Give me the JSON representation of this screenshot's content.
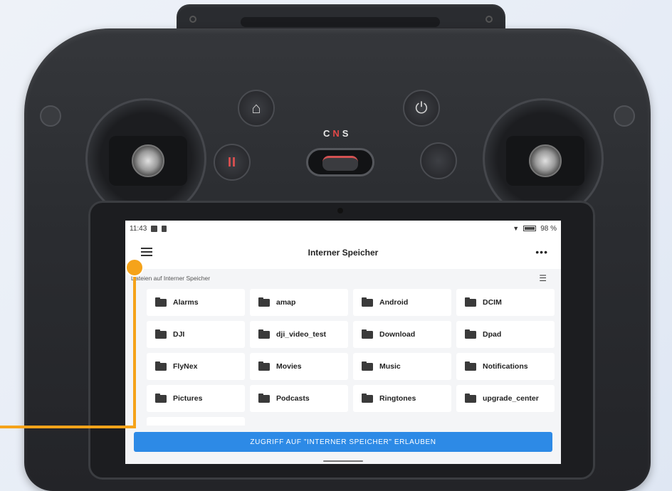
{
  "controller": {
    "mode_label_c": "C",
    "mode_label_n": "N",
    "mode_label_s": "S"
  },
  "statusbar": {
    "time": "11:43",
    "battery": "98 %"
  },
  "appbar": {
    "title": "Interner Speicher",
    "more": "•••"
  },
  "section": {
    "label": "Dateien auf Interner Speicher"
  },
  "folders": [
    "Alarms",
    "amap",
    "Android",
    "DCIM",
    "DJI",
    "dji_video_test",
    "Download",
    "Dpad",
    "FlyNex",
    "Movies",
    "Music",
    "Notifications",
    "Pictures",
    "Podcasts",
    "Ringtones",
    "upgrade_center"
  ],
  "allow_button": {
    "label": "ZUGRIFF AUF \"INTERNER SPEICHER\" ERLAUBEN"
  },
  "colors": {
    "accent": "#2d8ae6",
    "callout": "#f5a31a"
  }
}
